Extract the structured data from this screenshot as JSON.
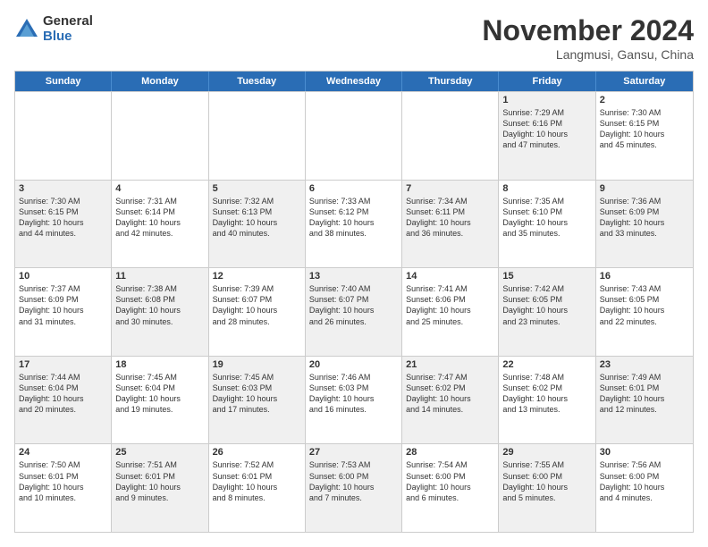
{
  "logo": {
    "general": "General",
    "blue": "Blue"
  },
  "title": "November 2024",
  "location": "Langmusi, Gansu, China",
  "header_days": [
    "Sunday",
    "Monday",
    "Tuesday",
    "Wednesday",
    "Thursday",
    "Friday",
    "Saturday"
  ],
  "rows": [
    {
      "cells": [
        {
          "empty": true
        },
        {
          "empty": true
        },
        {
          "empty": true
        },
        {
          "empty": true
        },
        {
          "empty": true
        },
        {
          "day": 1,
          "shaded": true,
          "lines": [
            "Sunrise: 7:29 AM",
            "Sunset: 6:16 PM",
            "Daylight: 10 hours",
            "and 47 minutes."
          ]
        },
        {
          "day": 2,
          "lines": [
            "Sunrise: 7:30 AM",
            "Sunset: 6:15 PM",
            "Daylight: 10 hours",
            "and 45 minutes."
          ]
        }
      ]
    },
    {
      "cells": [
        {
          "day": 3,
          "shaded": true,
          "lines": [
            "Sunrise: 7:30 AM",
            "Sunset: 6:15 PM",
            "Daylight: 10 hours",
            "and 44 minutes."
          ]
        },
        {
          "day": 4,
          "lines": [
            "Sunrise: 7:31 AM",
            "Sunset: 6:14 PM",
            "Daylight: 10 hours",
            "and 42 minutes."
          ]
        },
        {
          "day": 5,
          "shaded": true,
          "lines": [
            "Sunrise: 7:32 AM",
            "Sunset: 6:13 PM",
            "Daylight: 10 hours",
            "and 40 minutes."
          ]
        },
        {
          "day": 6,
          "lines": [
            "Sunrise: 7:33 AM",
            "Sunset: 6:12 PM",
            "Daylight: 10 hours",
            "and 38 minutes."
          ]
        },
        {
          "day": 7,
          "shaded": true,
          "lines": [
            "Sunrise: 7:34 AM",
            "Sunset: 6:11 PM",
            "Daylight: 10 hours",
            "and 36 minutes."
          ]
        },
        {
          "day": 8,
          "lines": [
            "Sunrise: 7:35 AM",
            "Sunset: 6:10 PM",
            "Daylight: 10 hours",
            "and 35 minutes."
          ]
        },
        {
          "day": 9,
          "shaded": true,
          "lines": [
            "Sunrise: 7:36 AM",
            "Sunset: 6:09 PM",
            "Daylight: 10 hours",
            "and 33 minutes."
          ]
        }
      ]
    },
    {
      "cells": [
        {
          "day": 10,
          "lines": [
            "Sunrise: 7:37 AM",
            "Sunset: 6:09 PM",
            "Daylight: 10 hours",
            "and 31 minutes."
          ]
        },
        {
          "day": 11,
          "shaded": true,
          "lines": [
            "Sunrise: 7:38 AM",
            "Sunset: 6:08 PM",
            "Daylight: 10 hours",
            "and 30 minutes."
          ]
        },
        {
          "day": 12,
          "lines": [
            "Sunrise: 7:39 AM",
            "Sunset: 6:07 PM",
            "Daylight: 10 hours",
            "and 28 minutes."
          ]
        },
        {
          "day": 13,
          "shaded": true,
          "lines": [
            "Sunrise: 7:40 AM",
            "Sunset: 6:07 PM",
            "Daylight: 10 hours",
            "and 26 minutes."
          ]
        },
        {
          "day": 14,
          "lines": [
            "Sunrise: 7:41 AM",
            "Sunset: 6:06 PM",
            "Daylight: 10 hours",
            "and 25 minutes."
          ]
        },
        {
          "day": 15,
          "shaded": true,
          "lines": [
            "Sunrise: 7:42 AM",
            "Sunset: 6:05 PM",
            "Daylight: 10 hours",
            "and 23 minutes."
          ]
        },
        {
          "day": 16,
          "lines": [
            "Sunrise: 7:43 AM",
            "Sunset: 6:05 PM",
            "Daylight: 10 hours",
            "and 22 minutes."
          ]
        }
      ]
    },
    {
      "cells": [
        {
          "day": 17,
          "shaded": true,
          "lines": [
            "Sunrise: 7:44 AM",
            "Sunset: 6:04 PM",
            "Daylight: 10 hours",
            "and 20 minutes."
          ]
        },
        {
          "day": 18,
          "lines": [
            "Sunrise: 7:45 AM",
            "Sunset: 6:04 PM",
            "Daylight: 10 hours",
            "and 19 minutes."
          ]
        },
        {
          "day": 19,
          "shaded": true,
          "lines": [
            "Sunrise: 7:45 AM",
            "Sunset: 6:03 PM",
            "Daylight: 10 hours",
            "and 17 minutes."
          ]
        },
        {
          "day": 20,
          "lines": [
            "Sunrise: 7:46 AM",
            "Sunset: 6:03 PM",
            "Daylight: 10 hours",
            "and 16 minutes."
          ]
        },
        {
          "day": 21,
          "shaded": true,
          "lines": [
            "Sunrise: 7:47 AM",
            "Sunset: 6:02 PM",
            "Daylight: 10 hours",
            "and 14 minutes."
          ]
        },
        {
          "day": 22,
          "lines": [
            "Sunrise: 7:48 AM",
            "Sunset: 6:02 PM",
            "Daylight: 10 hours",
            "and 13 minutes."
          ]
        },
        {
          "day": 23,
          "shaded": true,
          "lines": [
            "Sunrise: 7:49 AM",
            "Sunset: 6:01 PM",
            "Daylight: 10 hours",
            "and 12 minutes."
          ]
        }
      ]
    },
    {
      "cells": [
        {
          "day": 24,
          "lines": [
            "Sunrise: 7:50 AM",
            "Sunset: 6:01 PM",
            "Daylight: 10 hours",
            "and 10 minutes."
          ]
        },
        {
          "day": 25,
          "shaded": true,
          "lines": [
            "Sunrise: 7:51 AM",
            "Sunset: 6:01 PM",
            "Daylight: 10 hours",
            "and 9 minutes."
          ]
        },
        {
          "day": 26,
          "lines": [
            "Sunrise: 7:52 AM",
            "Sunset: 6:01 PM",
            "Daylight: 10 hours",
            "and 8 minutes."
          ]
        },
        {
          "day": 27,
          "shaded": true,
          "lines": [
            "Sunrise: 7:53 AM",
            "Sunset: 6:00 PM",
            "Daylight: 10 hours",
            "and 7 minutes."
          ]
        },
        {
          "day": 28,
          "lines": [
            "Sunrise: 7:54 AM",
            "Sunset: 6:00 PM",
            "Daylight: 10 hours",
            "and 6 minutes."
          ]
        },
        {
          "day": 29,
          "shaded": true,
          "lines": [
            "Sunrise: 7:55 AM",
            "Sunset: 6:00 PM",
            "Daylight: 10 hours",
            "and 5 minutes."
          ]
        },
        {
          "day": 30,
          "lines": [
            "Sunrise: 7:56 AM",
            "Sunset: 6:00 PM",
            "Daylight: 10 hours",
            "and 4 minutes."
          ]
        }
      ]
    }
  ]
}
